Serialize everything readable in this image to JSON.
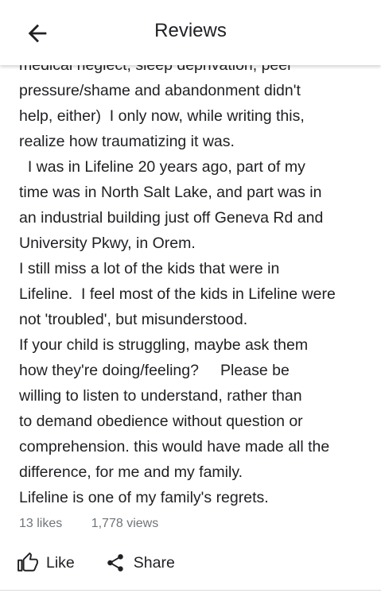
{
  "header": {
    "title": "Reviews",
    "back_icon": "arrow-back-icon"
  },
  "review": {
    "lines": [
      "medical neglect, sleep deprivation, peer",
      "pressure/shame and abandonment didn't",
      "help, either)  I only now, while writing this,",
      "realize how traumatizing it was.",
      "  I was in Lifeline 20 years ago, part of my",
      "time was in North Salt Lake, and part was in",
      "an industrial building just off Geneva Rd and",
      "University Pkwy, in Orem.",
      "I still miss a lot of the kids that were in",
      "Lifeline.  I feel most of the kids in Lifeline were",
      "not 'troubled', but misunderstood.",
      "If your child is struggling, maybe ask them",
      "how they're doing/feeling?     Please be",
      "willing to listen to understand, rather than",
      "to demand obedience without question or",
      "comprehension. this would have made all the",
      "difference, for me and my family.",
      "Lifeline is one of my family's regrets."
    ]
  },
  "stats": {
    "likes": "13 likes",
    "views": "1,778 views"
  },
  "actions": {
    "like_label": "Like",
    "like_icon": "thumb-up-icon",
    "share_label": "Share",
    "share_icon": "share-icon"
  },
  "colors": {
    "text": "#202124",
    "secondary": "#70757a",
    "divider": "#dadce0"
  }
}
